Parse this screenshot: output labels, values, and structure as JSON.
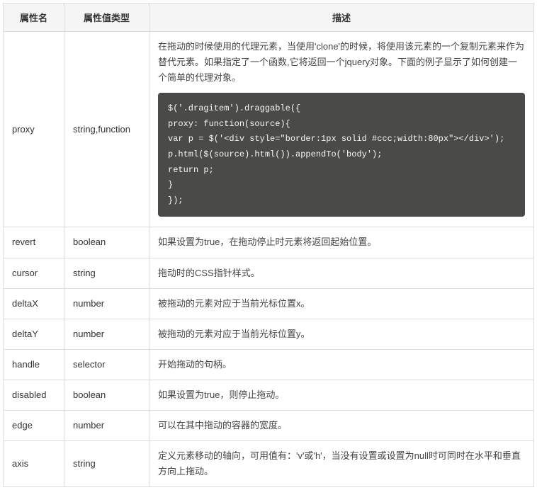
{
  "headers": {
    "name": "属性名",
    "type": "属性值类型",
    "desc": "描述"
  },
  "rows": [
    {
      "name": "proxy",
      "type": "string,function",
      "desc": "在拖动的时候使用的代理元素，当使用'clone'的时候，将使用该元素的一个复制元素来作为替代元素。如果指定了一个函数,它将返回一个jquery对象。下面的例子显示了如何创建一个简单的代理对象。",
      "code": "$('.dragitem').draggable({\nproxy: function(source){\nvar p = $('<div style=\"border:1px solid #ccc;width:80px\"></div>');\np.html($(source).html()).appendTo('body');\nreturn p;\n}\n});"
    },
    {
      "name": "revert",
      "type": "boolean",
      "desc": "如果设置为true，在拖动停止时元素将返回起始位置。"
    },
    {
      "name": "cursor",
      "type": "string",
      "desc": "拖动时的CSS指针样式。"
    },
    {
      "name": "deltaX",
      "type": "number",
      "desc": "被拖动的元素对应于当前光标位置x。"
    },
    {
      "name": "deltaY",
      "type": "number",
      "desc": "被拖动的元素对应于当前光标位置y。"
    },
    {
      "name": "handle",
      "type": "selector",
      "desc": "开始拖动的句柄。"
    },
    {
      "name": "disabled",
      "type": "boolean",
      "desc": "如果设置为true，则停止拖动。"
    },
    {
      "name": "edge",
      "type": "number",
      "desc": "可以在其中拖动的容器的宽度。"
    },
    {
      "name": "axis",
      "type": "string",
      "desc": "定义元素移动的轴向，可用值有：'v'或'h'，当没有设置或设置为null时可同时在水平和垂直方向上拖动。"
    }
  ]
}
